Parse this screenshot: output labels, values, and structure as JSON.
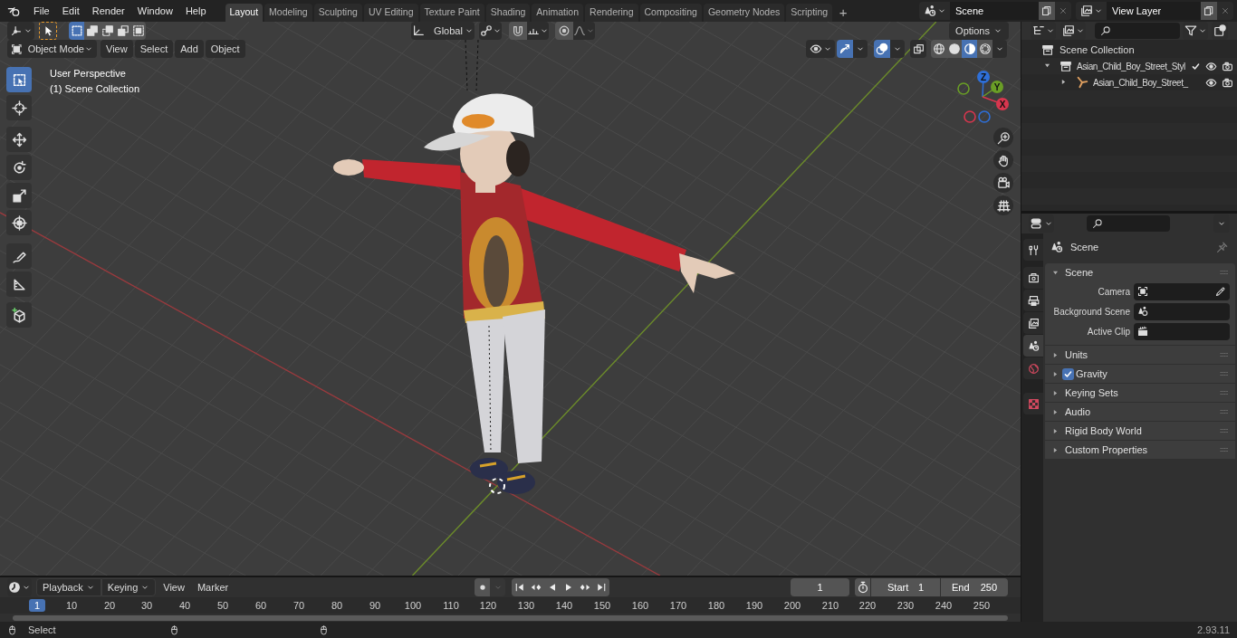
{
  "top_bar": {
    "menus": [
      "File",
      "Edit",
      "Render",
      "Window",
      "Help"
    ],
    "workspaces": [
      {
        "label": "Layout",
        "selected": true
      },
      {
        "label": "Modeling",
        "selected": false
      },
      {
        "label": "Sculpting",
        "selected": false
      },
      {
        "label": "UV Editing",
        "selected": false
      },
      {
        "label": "Texture Paint",
        "selected": false
      },
      {
        "label": "Shading",
        "selected": false
      },
      {
        "label": "Animation",
        "selected": false
      },
      {
        "label": "Rendering",
        "selected": false
      },
      {
        "label": "Compositing",
        "selected": false
      },
      {
        "label": "Geometry Nodes",
        "selected": false
      },
      {
        "label": "Scripting",
        "selected": false
      }
    ],
    "add_workspace": "+",
    "scene": "Scene",
    "view_layer": "View Layer"
  },
  "viewport": {
    "select_modes": [
      {
        "selected": true
      },
      {
        "selected": false
      },
      {
        "selected": false
      },
      {
        "selected": false
      },
      {
        "selected": false
      }
    ],
    "orientation": "Global",
    "options": "Options",
    "mode": "Object Mode",
    "menus": [
      "View",
      "Select",
      "Add",
      "Object"
    ],
    "gizmos": true,
    "overlays": true,
    "shading": [
      {
        "kind": "wireframe",
        "selected": false
      },
      {
        "kind": "solid",
        "selected": false
      },
      {
        "kind": "material",
        "selected": true
      },
      {
        "kind": "rendered",
        "selected": false
      }
    ],
    "overlay_text": [
      "User Perspective",
      "(1) Scene Collection"
    ],
    "tools": [
      {
        "kind": "select",
        "selected": true
      },
      {
        "kind": "cursor",
        "selected": false
      },
      {
        "kind": "move",
        "selected": false
      },
      {
        "kind": "rotate",
        "selected": false
      },
      {
        "kind": "scale",
        "selected": false
      },
      {
        "kind": "transform",
        "selected": false
      },
      {
        "kind": "annotate",
        "selected": false
      },
      {
        "kind": "measure",
        "selected": false
      },
      {
        "kind": "add_cube",
        "selected": false
      }
    ],
    "gizmo_axes": [
      {
        "label": "Z",
        "color": "#2e6fd8"
      },
      {
        "label": "Y",
        "color": "#6a9e26"
      },
      {
        "label": "X",
        "color": "#d8364e"
      }
    ]
  },
  "outliner": {
    "root": "Scene Collection",
    "items": [
      {
        "label": "Asian_Child_Boy_Street_Styl",
        "kind": "collection",
        "expanded": true,
        "checked": true,
        "children": [
          {
            "label": "Asian_Child_Boy_Street_",
            "kind": "armature",
            "expanded": false
          }
        ]
      }
    ]
  },
  "properties": {
    "tabs": [
      {
        "kind": "tool",
        "selected": false
      },
      {
        "kind": "render",
        "selected": false
      },
      {
        "kind": "output",
        "selected": false
      },
      {
        "kind": "view_layer",
        "selected": false
      },
      {
        "kind": "scene",
        "selected": true
      },
      {
        "kind": "world",
        "selected": false
      },
      {
        "kind": "texture",
        "selected": false
      }
    ],
    "context": "Scene",
    "panels": [
      {
        "label": "Scene",
        "expanded": true,
        "fields": [
          {
            "label": "Camera",
            "kind": "camera"
          },
          {
            "label": "Background Scene",
            "kind": "scene"
          },
          {
            "label": "Active Clip",
            "kind": "clip"
          }
        ]
      },
      {
        "label": "Units",
        "expanded": false
      },
      {
        "label": "Gravity",
        "expanded": false,
        "checked": true
      },
      {
        "label": "Keying Sets",
        "expanded": false
      },
      {
        "label": "Audio",
        "expanded": false
      },
      {
        "label": "Rigid Body World",
        "expanded": false
      },
      {
        "label": "Custom Properties",
        "expanded": false
      }
    ]
  },
  "timeline": {
    "menus": [
      {
        "label": "Playback",
        "dropdown": true
      },
      {
        "label": "Keying",
        "dropdown": true
      },
      {
        "label": "View",
        "dropdown": false
      },
      {
        "label": "Marker",
        "dropdown": false
      }
    ],
    "auto_keying": false,
    "current_frame": "1",
    "start_label": "Start",
    "start_value": "1",
    "end_label": "End",
    "end_value": "250",
    "playhead": "1",
    "ticks": [
      "10",
      "20",
      "30",
      "40",
      "50",
      "60",
      "70",
      "80",
      "90",
      "100",
      "110",
      "120",
      "130",
      "140",
      "150",
      "160",
      "170",
      "180",
      "190",
      "200",
      "210",
      "220",
      "230",
      "240",
      "250"
    ]
  },
  "status_bar": {
    "hint": "Select",
    "version": "2.93.11"
  }
}
